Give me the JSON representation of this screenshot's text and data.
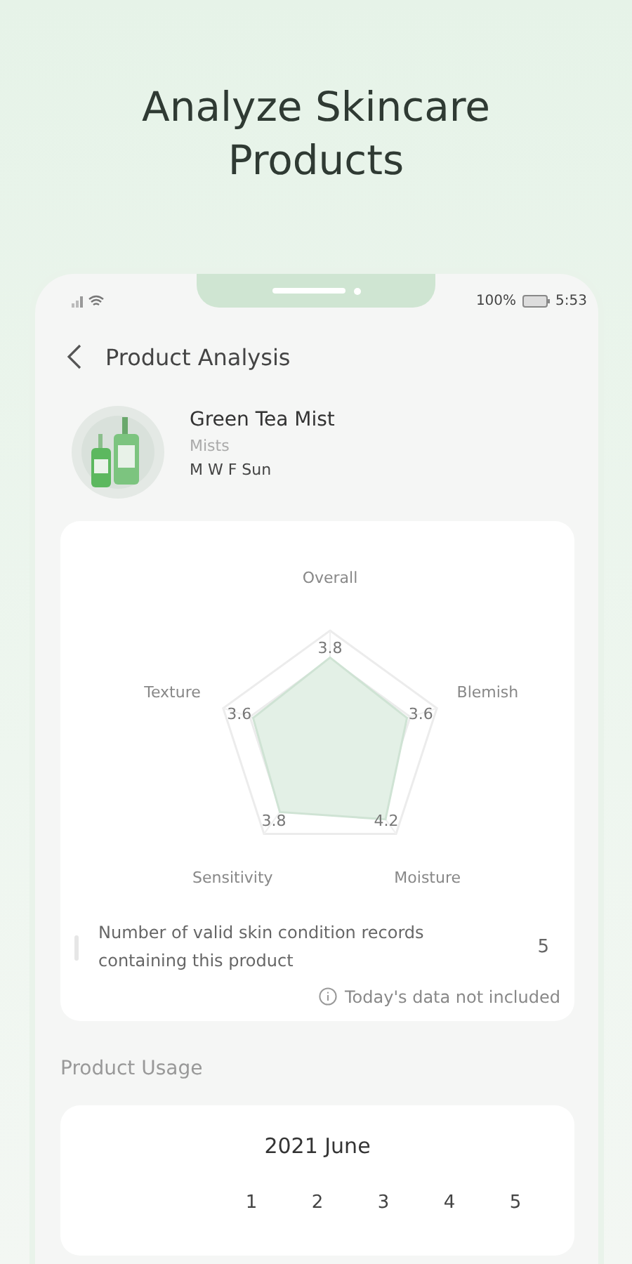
{
  "headline": "Analyze Skincare Products",
  "status_bar": {
    "battery": "100%",
    "time": "5:53"
  },
  "header": {
    "title": "Product Analysis"
  },
  "product": {
    "name": "Green Tea Mist",
    "category": "Mists",
    "schedule": "M W F Sun"
  },
  "radar": {
    "axes": [
      {
        "label": "Overall",
        "value": "3.8"
      },
      {
        "label": "Texture",
        "value": "3.6"
      },
      {
        "label": "Blemish",
        "value": "3.6"
      },
      {
        "label": "Sensitivity",
        "value": "3.8"
      },
      {
        "label": "Moisture",
        "value": "4.2"
      }
    ]
  },
  "records": {
    "label": "Number of valid skin condition records containing this product",
    "count": "5"
  },
  "note": "Today's data not included",
  "usage": {
    "title": "Product Usage",
    "month": "2021 June",
    "days": [
      "1",
      "2",
      "3",
      "4",
      "5"
    ]
  }
}
